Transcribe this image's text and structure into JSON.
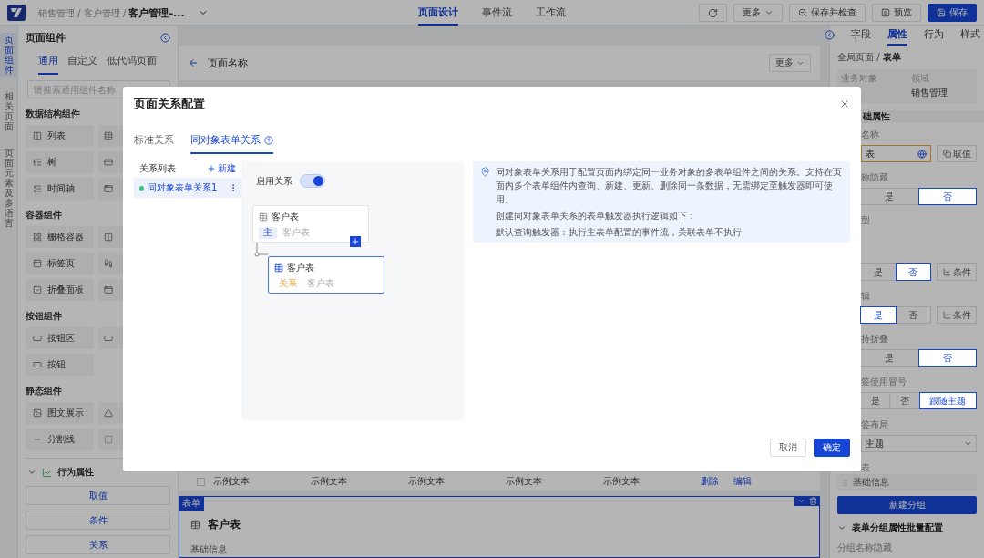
{
  "header": {
    "breadcrumb": "销售管理 / 客户管理 / **客户管理-...**",
    "tabs": [
      {
        "label": "页面设计",
        "selected": true
      },
      {
        "label": "事件流",
        "selected": false
      },
      {
        "label": "工作流",
        "selected": false
      }
    ],
    "actions": [
      {
        "kind": "refresh"
      },
      {
        "kind": "more",
        "label": "更多"
      },
      {
        "kind": "check",
        "label": "保存并检查"
      },
      {
        "kind": "preview",
        "label": "预览"
      },
      {
        "kind": "save",
        "label": "保存"
      }
    ]
  },
  "rail": [
    {
      "label": "页面组件",
      "selected": true
    },
    {
      "label": "相关页面",
      "selected": false
    },
    {
      "label": "页面元素及多语言",
      "selected": false
    }
  ],
  "left_panel": {
    "title": "页面组件",
    "tabs": [
      {
        "label": "通用",
        "selected": true
      },
      {
        "label": "自定义",
        "selected": false
      },
      {
        "label": "低代码页面",
        "selected": false
      }
    ],
    "search": {
      "placeholder": "请搜索通用组件名称"
    },
    "groups": [
      {
        "title": "数据结构组件",
        "items": [
          {
            "label": "列表"
          },
          {
            "kind": "covered"
          },
          {
            "label": "树"
          },
          {
            "kind": "covered"
          },
          {
            "label": "时间轴"
          },
          {
            "kind": "covered"
          }
        ]
      },
      {
        "title": "容器组件",
        "items": [
          {
            "label": "栅格容器"
          },
          {
            "kind": "covered"
          },
          {
            "label": "标签页"
          },
          {
            "kind": "covered"
          },
          {
            "label": "折叠面板"
          },
          {
            "kind": "covered"
          }
        ]
      },
      {
        "title": "按钮组件",
        "items": [
          {
            "label": "按钮区"
          },
          {
            "kind": "covered"
          },
          {
            "label": "按钮"
          }
        ]
      },
      {
        "title": "静态组件",
        "items": [
          {
            "label": "图文展示"
          },
          {
            "kind": "covered"
          },
          {
            "label": "分割线"
          },
          {
            "kind": "covered"
          }
        ]
      }
    ],
    "behavior": {
      "title": "行为属性",
      "expanded": true,
      "buttons": [
        "取值",
        "条件",
        "关系"
      ]
    }
  },
  "center": {
    "page_title": "页面名称",
    "more": "更多",
    "table_row": {
      "checked": false,
      "cells": [
        "示例文本",
        "示例文本",
        "示例文本",
        "示例文本",
        "示例文本"
      ],
      "actions": [
        "删除",
        "编辑"
      ]
    },
    "form": {
      "tag": "表单",
      "title": "客户表",
      "section": "基础信息"
    }
  },
  "right_panel": {
    "tabs": [
      {
        "label": "字段",
        "selected": false
      },
      {
        "label": "属性",
        "selected": true
      },
      {
        "label": "行为",
        "selected": false
      },
      {
        "label": "样式",
        "selected": false
      }
    ],
    "breadcrumb": "全局页面 / **表单**",
    "info": [
      {
        "label": "业务对象"
      },
      {
        "label": "领域",
        "value": "销售管理"
      }
    ],
    "section": "础属性",
    "fields": [
      {
        "kind": "input",
        "label": "名称",
        "value": "表",
        "button": "取值"
      },
      {
        "kind": "segment",
        "label": "称隐藏",
        "options": [
          {
            "label": "是",
            "selected": false
          },
          {
            "label": "否",
            "selected": true
          }
        ]
      },
      {
        "kind": "label",
        "label": "型"
      },
      {
        "kind": "segment",
        "options": [
          {
            "label": "是",
            "selected": false
          },
          {
            "label": "否",
            "selected": true
          }
        ],
        "button": "条件"
      },
      {
        "kind": "segment",
        "label": "辑",
        "options": [
          {
            "label": "是",
            "selected": true
          },
          {
            "label": "否",
            "selected": false
          }
        ],
        "button": "条件"
      },
      {
        "kind": "segment",
        "label": "持折叠",
        "options": [
          {
            "label": "是",
            "selected": false
          },
          {
            "label": "否",
            "selected": true
          }
        ]
      },
      {
        "kind": "segment",
        "label": "签使用冒号",
        "options": [
          {
            "label": "是",
            "selected": false
          },
          {
            "label": "否",
            "selected": false
          },
          {
            "label": "跟随主题",
            "selected": true
          }
        ]
      },
      {
        "kind": "select",
        "label": "签布局",
        "value": "主题"
      },
      {
        "kind": "label",
        "label": "表"
      }
    ],
    "groups": [
      "基础信息"
    ],
    "add_group": "新建分组",
    "batch": {
      "title": "表单分组属性批量配置",
      "expanded": true,
      "label": "分组名称隐藏"
    }
  },
  "modal": {
    "title": "页面关系配置",
    "tabs": [
      {
        "label": "标准关系",
        "selected": false,
        "help": false
      },
      {
        "label": "同对象表单关系",
        "selected": true,
        "help": true
      }
    ],
    "list": {
      "title": "关系列表",
      "add": "新建",
      "items": [
        {
          "label": "同对象表单关系1",
          "selected": true
        }
      ]
    },
    "canvas": {
      "enable_label": "启用关系",
      "enabled": true,
      "nodes": [
        {
          "title": "客户表",
          "kind": "main",
          "tag": "主",
          "subtitle": "客户表",
          "selected": false
        },
        {
          "title": "客户表",
          "kind": "relation",
          "tag": "关系",
          "subtitle": "客户表",
          "selected": true
        }
      ]
    },
    "info": [
      "同对象表单关系用于配置页面内绑定同一业务对象的多表单组件之间的关系。支持在页面内多个表单组件内查询、新建、更新、删除同一条数据，无需绑定至触发器即可使用。",
      "创建同对象表单关系的表单触发器执行逻辑如下：",
      "默认查询触发器：执行主表单配置的事件流，关联表单不执行"
    ],
    "buttons": [
      {
        "kind": "secondary",
        "label": "取消"
      },
      {
        "kind": "primary",
        "label": "确定"
      }
    ]
  }
}
